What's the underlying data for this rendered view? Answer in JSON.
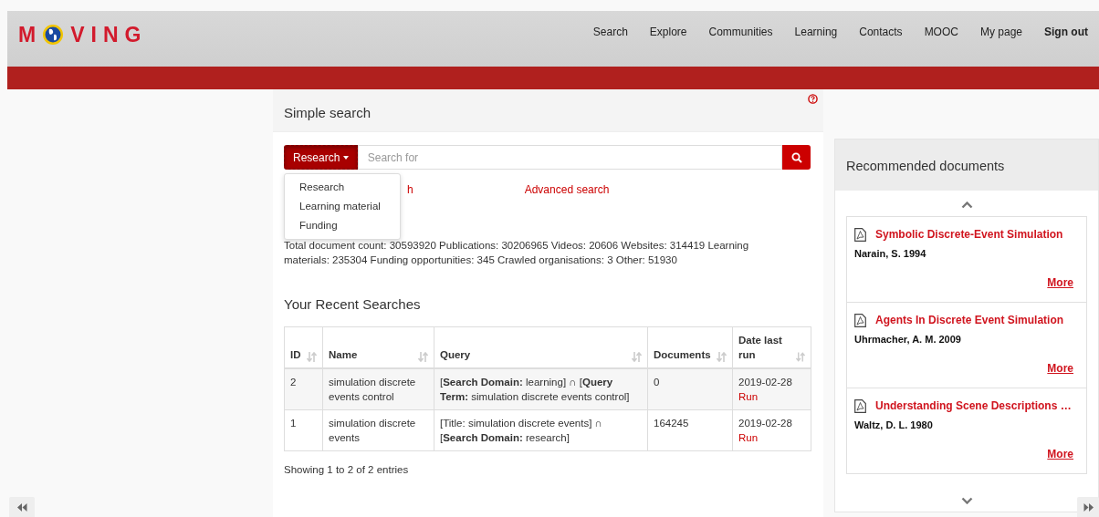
{
  "header": {
    "logo": [
      "M",
      "VING"
    ],
    "nav": [
      {
        "label": "Search",
        "bold": false
      },
      {
        "label": "Explore",
        "bold": false
      },
      {
        "label": "Communities",
        "bold": false
      },
      {
        "label": "Learning",
        "bold": false
      },
      {
        "label": "Contacts",
        "bold": false
      },
      {
        "label": "MOOC",
        "bold": false
      },
      {
        "label": "My page",
        "bold": false
      },
      {
        "label": "Sign out",
        "bold": true
      }
    ]
  },
  "search_panel": {
    "title": "Simple search",
    "scope": {
      "label": "Research",
      "expanded": true,
      "options": [
        "Research",
        "Learning material",
        "Funding"
      ]
    },
    "search": {
      "placeholder": "Search for"
    },
    "links": [
      "h",
      "Advanced search"
    ],
    "stats": "Total document count: 30593920 Publications: 30206965 Videos: 20606 Websites: 314419 Learning materials: 235304 Funding opportunities: 345 Crawled organisations: 3 Other: 51930"
  },
  "recent_searches": {
    "title": "Your Recent Searches",
    "columns": [
      "ID",
      "Name",
      "Query",
      "Documents",
      "Date last run"
    ],
    "rows": [
      {
        "id": "2",
        "name": "simulation discrete events control",
        "query": "[**Search Domain:** learning] ∩ [**Query Term:** simulation discrete events control]",
        "documents": "0",
        "date": "2019-02-28",
        "action": "Run"
      },
      {
        "id": "1",
        "name": "simulation discrete events",
        "query": "[Title: simulation discrete events] ∩ [**Search Domain:** research]",
        "documents": "164245",
        "date": "2019-02-28",
        "action": "Run"
      }
    ],
    "footer": "Showing 1 to 2 of 2 entries"
  },
  "recommended": {
    "title": "Recommended documents",
    "items": [
      {
        "title": "Symbolic Discrete-Event Simulation",
        "author": "Narain, S. 1994",
        "more": "More"
      },
      {
        "title": "Agents In Discrete Event Simulation",
        "author": "Uhrmacher, A. M. 2009",
        "more": "More"
      },
      {
        "title": "Understanding Scene Descriptions …",
        "author": "Waltz, D. L. 1980",
        "more": "More"
      }
    ]
  }
}
